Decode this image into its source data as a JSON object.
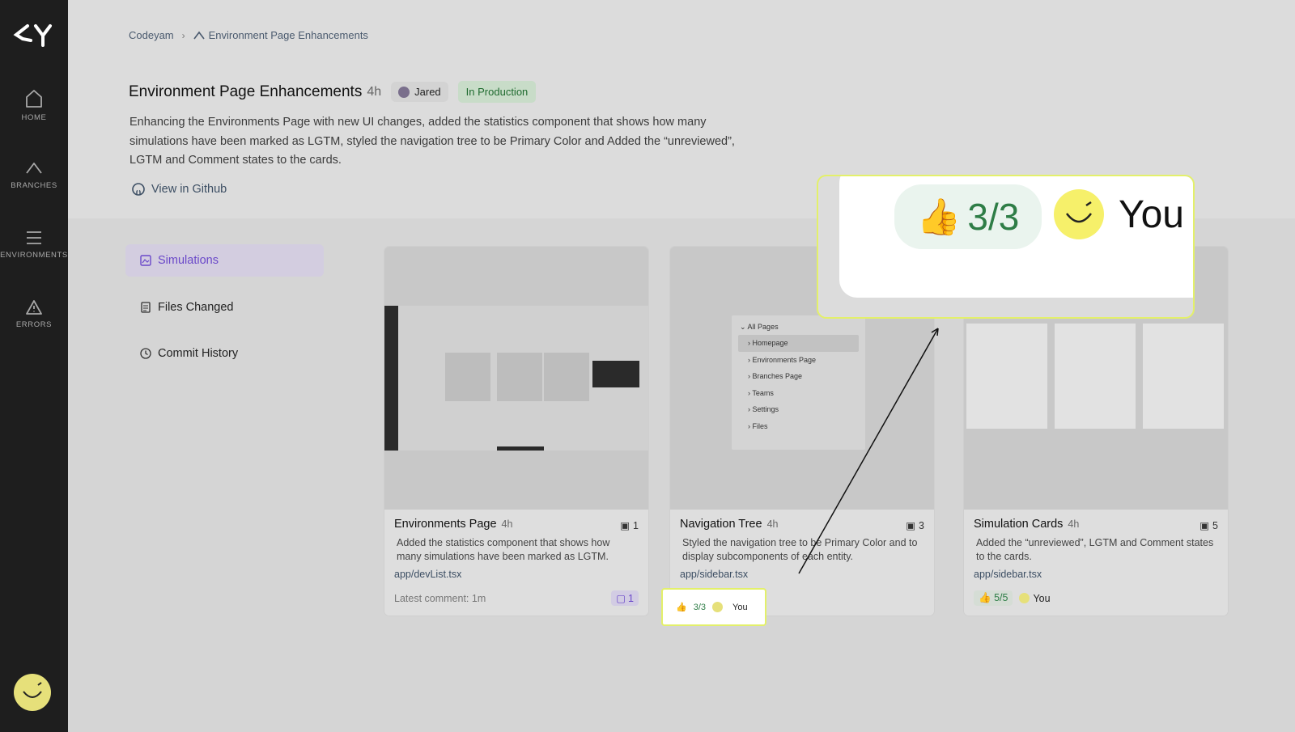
{
  "sidebar": {
    "items": [
      {
        "label": "HOME",
        "icon": "home-icon"
      },
      {
        "label": "BRANCHES",
        "icon": "branches-icon"
      },
      {
        "label": "ENVIRONMENTS",
        "icon": "menu-icon"
      },
      {
        "label": "ERRORS",
        "icon": "warning-icon"
      }
    ]
  },
  "breadcrumb": {
    "root": "Codeyam",
    "branch": "Environment Page Enhancements"
  },
  "header": {
    "title": "Environment Page Enhancements",
    "age": "4h",
    "user": "Jared",
    "status": "In Production",
    "description": "Enhancing the Environments Page with new UI changes, added the statistics component that shows how many simulations have been marked as LGTM, styled the navigation tree to be Primary Color and Added the “unreviewed”, LGTM and Comment states to the cards.",
    "github_link": "View in Github"
  },
  "tabs": [
    {
      "label": "Simulations"
    },
    {
      "label": "Files Changed"
    },
    {
      "label": "Commit History"
    }
  ],
  "cards": [
    {
      "title": "Environments Page",
      "age": "4h",
      "count": "1",
      "description": "Added the statistics component that shows how many simulations have been marked as LGTM.",
      "file": "app/devList.tsx",
      "footer": "Latest comment: 1m",
      "comments": "1"
    },
    {
      "title": "Navigation Tree",
      "age": "4h",
      "count": "3",
      "description": "Styled the navigation tree to be Primary Color and to display subcomponents of each entity.",
      "file": "app/sidebar.tsx",
      "tree": {
        "header": "All Pages",
        "items": [
          "Homepage",
          "Environments Page",
          "Branches Page",
          "Teams",
          "Settings",
          "Files"
        ]
      }
    },
    {
      "title": "Simulation Cards",
      "age": "4h",
      "count": "5",
      "description": "Added the “unreviewed”, LGTM and Comment states to the cards.",
      "file": "app/sidebar.tsx",
      "lgtm": "5/5",
      "you": "You"
    }
  ],
  "callout": {
    "lgtm": "3/3",
    "you": "You"
  },
  "colors": {
    "sidebar_bg": "#1e1e1e",
    "accent_purple": "#6a48c9",
    "lgtm_green": "#2e7d46",
    "highlight_yellow": "#e3f06a"
  }
}
